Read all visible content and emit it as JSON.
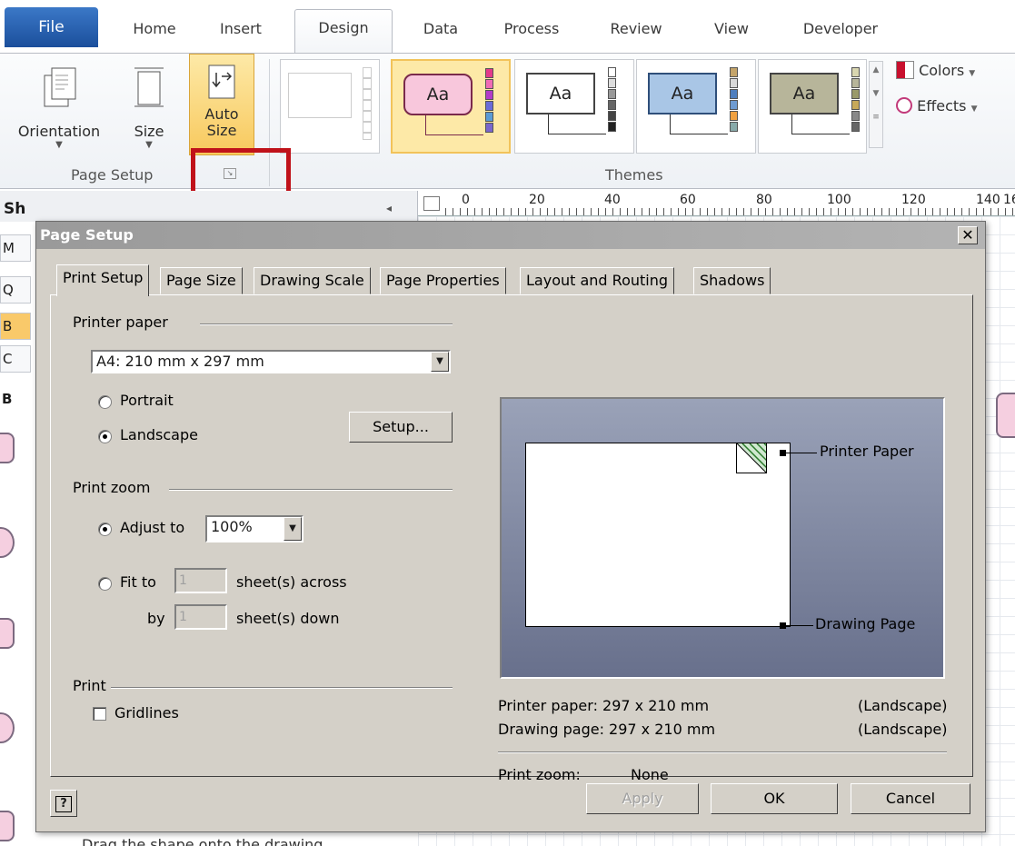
{
  "ribbon": {
    "tabs": [
      "File",
      "Home",
      "Insert",
      "Design",
      "Data",
      "Process",
      "Review",
      "View",
      "Developer"
    ],
    "buttons": {
      "orientation": "Orientation",
      "size": "Size",
      "auto_size_1": "Auto",
      "auto_size_2": "Size"
    },
    "groups": {
      "page_setup": "Page Setup",
      "themes": "Themes"
    },
    "side": {
      "colors": "Colors",
      "effects": "Effects"
    },
    "theme_text": "Aa"
  },
  "shapes_panel": {
    "title_partial": "Sh",
    "buttons": [
      "M",
      "Q",
      "B",
      "C"
    ],
    "section": "B",
    "footer_partial": "Drag the shape onto the drawing"
  },
  "ruler": {
    "ticks": [
      "0",
      "20",
      "40",
      "60",
      "80",
      "100",
      "120",
      "140",
      "16"
    ]
  },
  "dialog": {
    "title": "Page Setup",
    "close": "x",
    "tabs": [
      "Print Setup",
      "Page Size",
      "Drawing Scale",
      "Page Properties",
      "Layout and Routing",
      "Shadows"
    ],
    "printer_paper": {
      "label": "Printer paper",
      "value": "A4:  210 mm x 297 mm",
      "portrait": "Portrait",
      "landscape": "Landscape",
      "setup": "Setup...",
      "selected": "Landscape"
    },
    "print_zoom": {
      "label": "Print zoom",
      "adjust_to": "Adjust to",
      "adjust_value": "100%",
      "fit_to": "Fit to",
      "across_value": "1",
      "across_label": "sheet(s) across",
      "by": "by",
      "down_value": "1",
      "down_label": "sheet(s) down",
      "selected": "Adjust to"
    },
    "print": {
      "label": "Print",
      "gridlines": "Gridlines",
      "gridlines_checked": false
    },
    "preview": {
      "printer_paper_label": "Printer Paper",
      "drawing_page_label": "Drawing Page"
    },
    "info": {
      "printer_paper": "Printer paper:  297 x 210 mm",
      "printer_paper_orient": "(Landscape)",
      "drawing_page": "Drawing page: 297 x 210 mm",
      "drawing_page_orient": "(Landscape)",
      "print_zoom_label": "Print zoom:",
      "print_zoom_value": "None"
    },
    "help": "?",
    "buttons": {
      "apply": "Apply",
      "ok": "OK",
      "cancel": "Cancel"
    }
  }
}
